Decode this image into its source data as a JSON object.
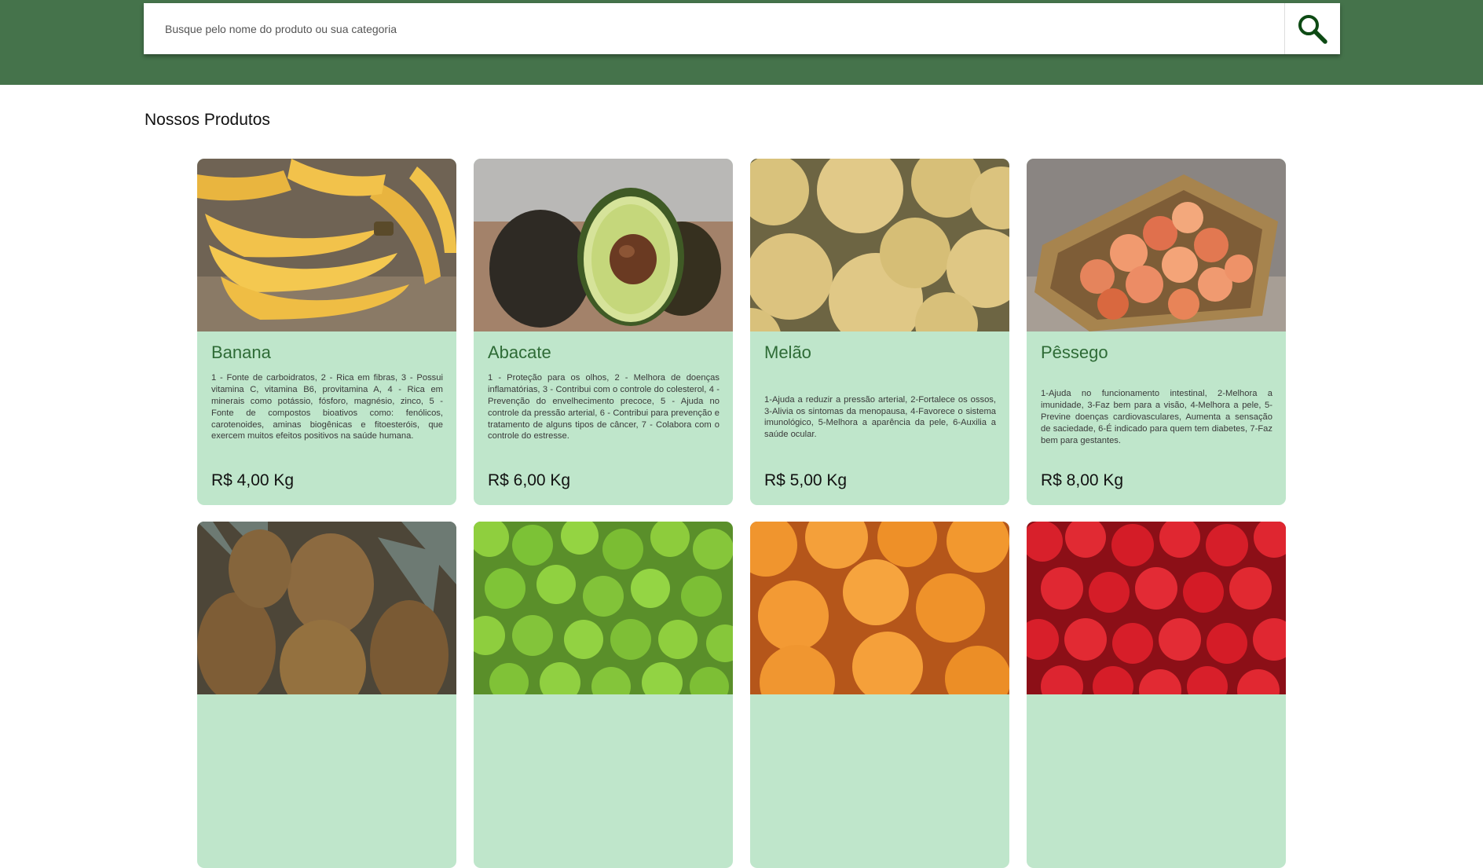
{
  "search": {
    "placeholder": "Busque pelo nome do produto ou sua categoria"
  },
  "section": {
    "title": "Nossos Produtos"
  },
  "products": [
    {
      "name": "Banana",
      "description": "1 - Fonte de carboidratos, 2 - Rica em fibras, 3 - Possui vitamina C, vitamina B6, provitamina A, 4 - Rica em minerais como potássio, fósforo, magnésio, zinco, 5 - Fonte de compostos bioativos como: fenólicos, carotenoides, aminas biogênicas e fitoesteróis, que exercem muitos efeitos positivos na saúde humana.",
      "price": "R$ 4,00 Kg"
    },
    {
      "name": "Abacate",
      "description": "1 - Proteção para os olhos, 2 - Melhora de doenças inflamatórias, 3 - Contribui com o controle do colesterol, 4 - Prevenção do envelhecimento precoce, 5 - Ajuda no controle da pressão arterial, 6 - Contribui para prevenção e tratamento de alguns tipos de câncer, 7 - Colabora com o controle do estresse.",
      "price": "R$ 6,00 Kg"
    },
    {
      "name": "Melão",
      "description": "1-Ajuda a reduzir a pressão arterial, 2-Fortalece os ossos, 3-Alivia os sintomas da menopausa, 4-Favorece o sistema imunológico, 5-Melhora a aparência da pele, 6-Auxilia a saúde ocular.",
      "price": "R$ 5,00 Kg"
    },
    {
      "name": "Pêssego",
      "description": "1-Ajuda no funcionamento intestinal, 2-Melhora a imunidade, 3-Faz bem para a visão, 4-Melhora a pele, 5-Previne doenças cardiovasculares, Aumenta a sensação de saciedade, 6-É indicado para quem tem diabetes, 7-Faz bem para gestantes.",
      "price": "R$ 8,00 Kg"
    }
  ],
  "colors": {
    "header": "#45734b",
    "card": "#bfe6cb",
    "product_name": "#2e6b36"
  },
  "icons": {
    "search": "magnifier-icon"
  }
}
